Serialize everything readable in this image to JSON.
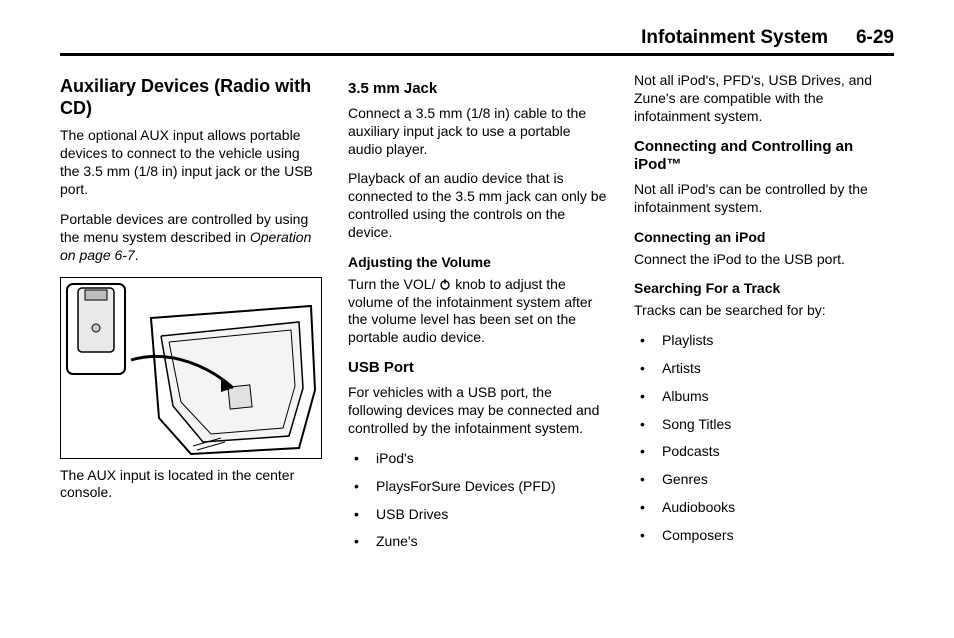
{
  "header": {
    "section": "Infotainment System",
    "page": "6-29"
  },
  "col1": {
    "h1": "Auxiliary Devices (Radio with CD)",
    "p1": "The optional AUX input allows portable devices to connect to the vehicle using the 3.5 mm (1/8 in) input jack or the USB port.",
    "p2a": "Portable devices are controlled by using the menu system described in ",
    "p2b": "Operation on page 6-7",
    "p2c": ".",
    "caption": "The AUX input is located in the center console."
  },
  "col2": {
    "h_jack": "3.5 mm Jack",
    "jack_p1": "Connect a 3.5 mm  (1/8 in) cable to the auxiliary input jack to use a portable audio player.",
    "jack_p2": "Playback of an audio device that is connected to the 3.5 mm jack can only be controlled using the controls on the device.",
    "h_vol": "Adjusting the Volume",
    "vol_a": "Turn the VOL/ ",
    "vol_b": " knob to adjust the volume of the infotainment system after the volume level has been set on the portable audio device.",
    "h_usb": "USB Port",
    "usb_p": "For vehicles with a USB port, the following devices may be connected and controlled by the infotainment system.",
    "usb_list": [
      "iPod's",
      "PlaysForSure Devices (PFD)",
      "USB Drives",
      "Zune's"
    ]
  },
  "col3": {
    "p_top": "Not all iPod's, PFD's, USB Drives, and Zune's are compatible with the infotainment system.",
    "h_ipod": "Connecting and Controlling an iPod™",
    "ipod_p": "Not all iPod's can be controlled by the infotainment system.",
    "h_conn": "Connecting an iPod",
    "conn_p": "Connect the iPod to the USB port.",
    "h_search": "Searching For a Track",
    "search_p": "Tracks can be searched for by:",
    "search_list": [
      "Playlists",
      "Artists",
      "Albums",
      "Song Titles",
      "Podcasts",
      "Genres",
      "Audiobooks",
      "Composers"
    ]
  }
}
